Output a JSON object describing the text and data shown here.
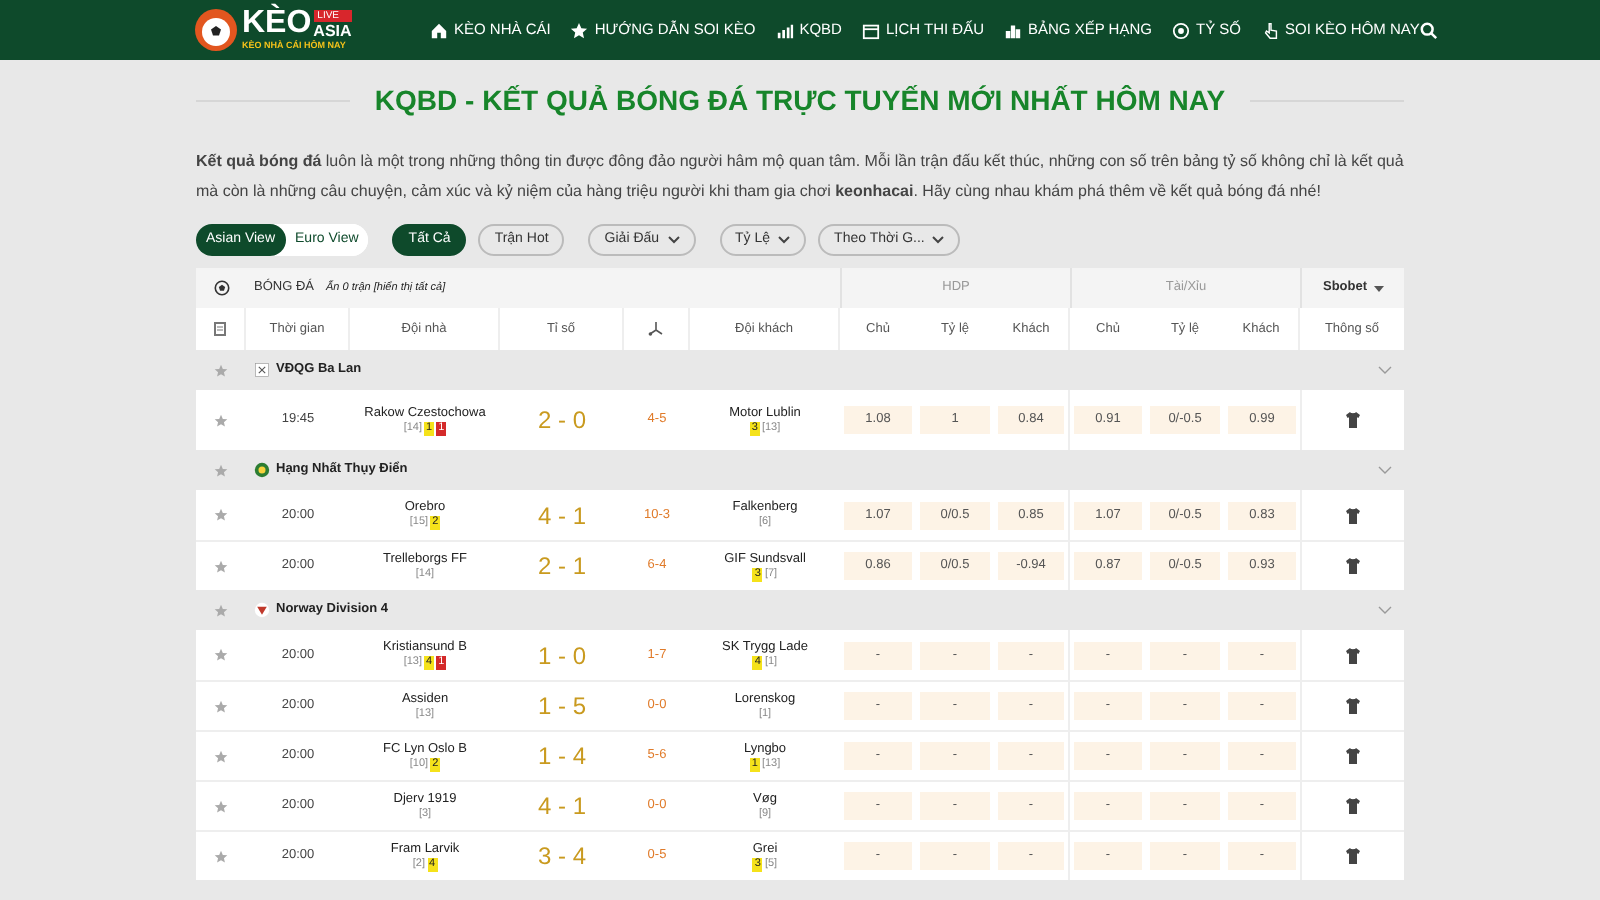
{
  "logo": {
    "word": "KÈO",
    "live": "LIVE",
    "asia": "ASIA",
    "tagline": "KÈO NHÀ CÁI HÔM NAY"
  },
  "nav": [
    {
      "label": "KÈO NHÀ CÁI",
      "kind": "home"
    },
    {
      "label": "HƯỚNG DẪN SOI KÈO",
      "kind": "star"
    },
    {
      "label": "KQBD",
      "kind": "chart"
    },
    {
      "label": "LỊCH THI ĐẤU",
      "kind": "calendar"
    },
    {
      "label": "BẢNG XẾP HẠNG",
      "kind": "ranking"
    },
    {
      "label": "TỶ SỐ",
      "kind": "ball"
    },
    {
      "label": "SOI KÈO HÔM NAY",
      "kind": "hand"
    }
  ],
  "title": "KQBD - KẾT QUẢ BÓNG ĐÁ TRỰC TUYẾN MỚI NHẤT HÔM NAY",
  "intro": "**Kết quả bóng đá** luôn là một trong những thông tin được đông đảo người hâm mộ quan tâm. Mỗi lần trận đấu kết thúc, những con số trên bảng tỷ số không chỉ là kết quả mà còn là những câu chuyện, cảm xúc và kỷ niệm của hàng triệu người khi tham gia chơi **keonhacai**. Hãy cùng nhau khám phá thêm về kết quả bóng đá nhé!",
  "view_toggle": [
    {
      "label": "Asian View",
      "selected": true
    },
    {
      "label": "Euro View",
      "selected": false
    }
  ],
  "filters": [
    {
      "label": "Tất Cả",
      "selected": true,
      "dropdown": false
    },
    {
      "label": "Trận Hot",
      "selected": false,
      "dropdown": false
    },
    {
      "label": "Giải Đấu",
      "selected": false,
      "dropdown": true
    },
    {
      "label": "Tỷ Lệ",
      "selected": false,
      "dropdown": true
    },
    {
      "label": "Theo Thời G...",
      "selected": false,
      "dropdown": true
    }
  ],
  "table": {
    "sport": "BÓNG ĐÁ",
    "hidden_note": "Ẩn *0* trận *[hiển thị tất cả]*",
    "hdp": "HDP",
    "taixiu": "Tài/Xỉu",
    "bookmaker": "Sbobet",
    "columns": [
      "Thời gian",
      "Đội nhà",
      "Tỉ số",
      "Đội khách",
      "Chủ",
      "Tỷ lệ",
      "Khách",
      "Chủ",
      "Tỷ lệ",
      "Khách",
      "Thông số"
    ],
    "groups": [
      {
        "league": "VĐQG Ba Lan",
        "matches": [
          {
            "time": "19:45",
            "home": "Rakow Czestochowa",
            "home_meta": [
              {
                "kind": "rank",
                "text": "[14]"
              },
              {
                "kind": "yellow",
                "text": "1"
              },
              {
                "kind": "red",
                "text": "1"
              }
            ],
            "score": "2 - 0",
            "corners": "4-5",
            "away": "Motor Lublin",
            "away_meta": [
              {
                "kind": "yellow",
                "text": "3"
              },
              {
                "kind": "rank",
                "text": "[13]"
              }
            ],
            "odds": [
              "1.08",
              "1",
              "0.84",
              "0.91",
              "0/-0.5",
              "0.99"
            ]
          }
        ]
      },
      {
        "league": "Hạng Nhất Thụy Điển",
        "matches": [
          {
            "time": "20:00",
            "home": "Orebro",
            "home_meta": [
              {
                "kind": "rank",
                "text": "[15]"
              },
              {
                "kind": "yellow",
                "text": "2"
              }
            ],
            "score": "4 - 1",
            "corners": "10-3",
            "away": "Falkenberg",
            "away_meta": [
              {
                "kind": "rank",
                "text": "[6]"
              }
            ],
            "odds": [
              "1.07",
              "0/0.5",
              "0.85",
              "1.07",
              "0/-0.5",
              "0.83"
            ]
          },
          {
            "time": "20:00",
            "home": "Trelleborgs FF",
            "home_meta": [
              {
                "kind": "rank",
                "text": "[14]"
              }
            ],
            "score": "2 - 1",
            "corners": "6-4",
            "away": "GIF Sundsvall",
            "away_meta": [
              {
                "kind": "yellow",
                "text": "3"
              },
              {
                "kind": "rank",
                "text": "[7]"
              }
            ],
            "odds": [
              "0.86",
              "0/0.5",
              "-0.94",
              "0.87",
              "0/-0.5",
              "0.93"
            ]
          }
        ]
      },
      {
        "league": "Norway Division 4",
        "matches": [
          {
            "time": "20:00",
            "home": "Kristiansund B",
            "home_meta": [
              {
                "kind": "rank",
                "text": "[13]"
              },
              {
                "kind": "yellow",
                "text": "4"
              },
              {
                "kind": "red",
                "text": "1"
              }
            ],
            "score": "1 - 0",
            "corners": "1-7",
            "away": "SK Trygg Lade",
            "away_meta": [
              {
                "kind": "yellow",
                "text": "4"
              },
              {
                "kind": "rank",
                "text": "[1]"
              }
            ],
            "odds": [
              "-",
              "-",
              "-",
              "-",
              "-",
              "-"
            ]
          },
          {
            "time": "20:00",
            "home": "Assiden",
            "home_meta": [
              {
                "kind": "rank",
                "text": "[13]"
              }
            ],
            "score": "1 - 5",
            "corners": "0-0",
            "away": "Lorenskog",
            "away_meta": [
              {
                "kind": "rank",
                "text": "[1]"
              }
            ],
            "odds": [
              "-",
              "-",
              "-",
              "-",
              "-",
              "-"
            ]
          },
          {
            "time": "20:00",
            "home": "FC Lyn Oslo B",
            "home_meta": [
              {
                "kind": "rank",
                "text": "[10]"
              },
              {
                "kind": "yellow",
                "text": "2"
              }
            ],
            "score": "1 - 4",
            "corners": "5-6",
            "away": "Lyngbo",
            "away_meta": [
              {
                "kind": "yellow",
                "text": "1"
              },
              {
                "kind": "rank",
                "text": "[13]"
              }
            ],
            "odds": [
              "-",
              "-",
              "-",
              "-",
              "-",
              "-"
            ]
          },
          {
            "time": "20:00",
            "home": "Djerv 1919",
            "home_meta": [
              {
                "kind": "rank",
                "text": "[3]"
              }
            ],
            "score": "4 - 1",
            "corners": "0-0",
            "away": "Vøg",
            "away_meta": [
              {
                "kind": "rank",
                "text": "[9]"
              }
            ],
            "odds": [
              "-",
              "-",
              "-",
              "-",
              "-",
              "-"
            ]
          },
          {
            "time": "20:00",
            "home": "Fram Larvik",
            "home_meta": [
              {
                "kind": "rank",
                "text": "[2]"
              },
              {
                "kind": "yellow",
                "text": "4"
              }
            ],
            "score": "3 - 4",
            "corners": "0-5",
            "away": "Grei",
            "away_meta": [
              {
                "kind": "yellow",
                "text": "3"
              },
              {
                "kind": "rank",
                "text": "[5]"
              }
            ],
            "odds": [
              "-",
              "-",
              "-",
              "-",
              "-",
              "-"
            ]
          }
        ]
      }
    ]
  }
}
